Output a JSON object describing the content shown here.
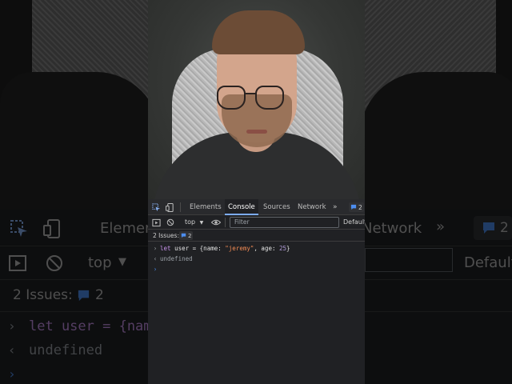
{
  "devtools": {
    "tabs": [
      {
        "label": "Elements",
        "active": false
      },
      {
        "label": "Console",
        "active": true
      },
      {
        "label": "Sources",
        "active": false
      },
      {
        "label": "Network",
        "active": false
      }
    ],
    "more_tabs": "»",
    "message_badge_count": "2",
    "toolbar": {
      "context": "top",
      "filter_placeholder": "Filter",
      "log_levels": "Default"
    },
    "issues": {
      "label": "2 Issues:",
      "count": "2"
    },
    "console": {
      "input": {
        "keyword": "let",
        "variable": "user",
        "op": "=",
        "open": "{name:",
        "name_value": "\"jeremy\"",
        "age_key": ", age:",
        "age_value": "25",
        "close": "}"
      },
      "result": "undefined"
    }
  },
  "background": {
    "tab_partial_left": "Elemen",
    "tab_partial_right": "Network",
    "badge": "2",
    "context": "top",
    "levels": "Default",
    "issues_label": "2 Issues:",
    "issues_count": "2",
    "input_partial": "let user = {nam",
    "result": "undefined"
  },
  "colors": {
    "accent": "#7cacf8",
    "panel_bg": "#202124",
    "string": "#f28b54",
    "keyword": "#c792ea"
  }
}
